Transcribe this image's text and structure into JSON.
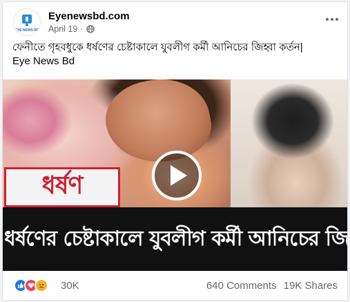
{
  "post": {
    "page_name": "Eyenewsbd.com",
    "date": "April 19",
    "separator": "·",
    "avatar_text": "EYE NEWS BD",
    "text_line1": "ফেনীতে গৃহবধুকে ধর্ষণের চেষ্টাকালে যুবলীগ কর্মী আনিচের জিহ্বা কর্তন|",
    "text_line2": "Eye News Bd"
  },
  "media": {
    "overlay_word": "ধর্ষণ",
    "banner_text": "গৃহবধুকে ধর্ষণের চেষ্টাকালে যুবলীগ কর্মী আনিচের জিহ্বা কর্তন"
  },
  "footer": {
    "reaction_icons": [
      "like-icon",
      "love-icon",
      "sad-icon"
    ],
    "reaction_count": "30K",
    "comments": "640 Comments",
    "shares": "19K Shares"
  },
  "colors": {
    "like": "#1877f2",
    "love": "#f33e58",
    "sad": "#f7b125",
    "accent_red": "#d01f2f"
  }
}
